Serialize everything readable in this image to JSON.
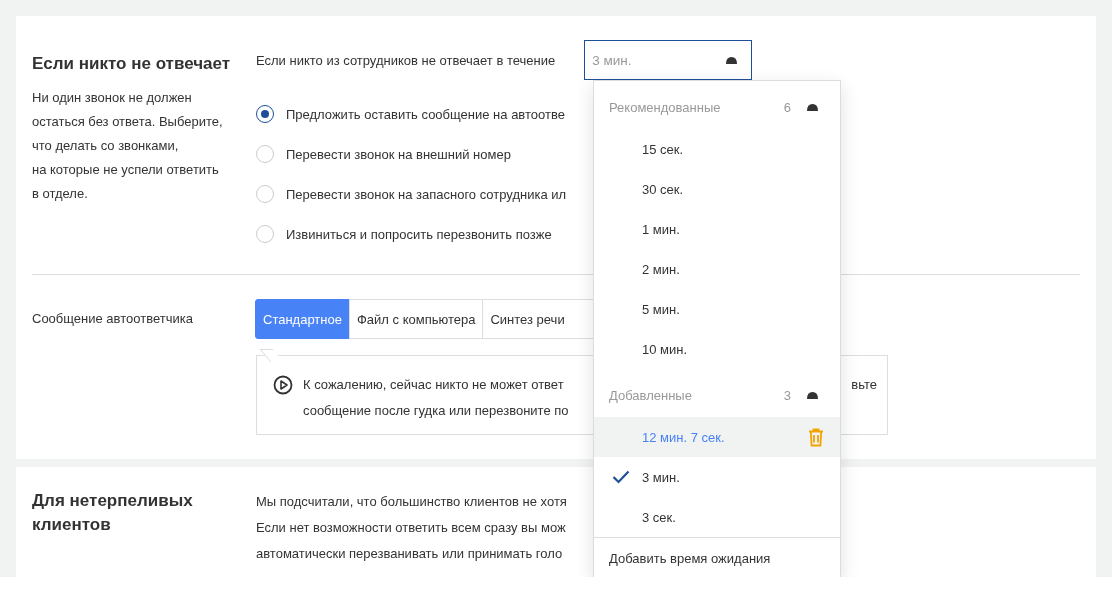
{
  "no_answer": {
    "title": "Если никто не отвечает",
    "description": "Ни один звонок не должен остаться без ответа. Выберите, что делать со звонками,\nна которые не успели ответить в отделе.",
    "timeout_label": "Если никто из сотрудников не отвечает в течение",
    "timeout_select": {
      "value": "3 мин.",
      "expanded": true
    },
    "options": [
      {
        "label": "Предложить оставить сообщение на автоотве",
        "selected": true
      },
      {
        "label": "Перевести звонок на внешний номер",
        "selected": false
      },
      {
        "label": "Перевести звонок на запасного сотрудника ил",
        "selected": false
      },
      {
        "label": "Извиниться и попросить перезвонить позже",
        "selected": false
      }
    ],
    "answering_machine": {
      "label": "Сообщение автоответчика",
      "tabs": [
        {
          "label": "Стандартное",
          "selected": true
        },
        {
          "label": "Файл с компьютера",
          "selected": false
        },
        {
          "label": "Синтез речи",
          "selected": false
        }
      ],
      "message_lines": [
        "К сожалению, сейчас никто не может ответ",
        "сообщение после гудка или перезвоните по"
      ],
      "message_tail": "вьте"
    }
  },
  "timeout_dropdown": {
    "groups": [
      {
        "title": "Рекомендованные",
        "count": "6",
        "expanded": true,
        "items": [
          {
            "label": "15 сек.",
            "selected": false,
            "hovered": false
          },
          {
            "label": "30 сек.",
            "selected": false,
            "hovered": false
          },
          {
            "label": "1 мин.",
            "selected": false,
            "hovered": false
          },
          {
            "label": "2 мин.",
            "selected": false,
            "hovered": false
          },
          {
            "label": "5 мин.",
            "selected": false,
            "hovered": false
          },
          {
            "label": "10 мин.",
            "selected": false,
            "hovered": false
          }
        ]
      },
      {
        "title": "Добавленные",
        "count": "3",
        "expanded": true,
        "items": [
          {
            "label": "12 мин. 7 сек.",
            "selected": false,
            "hovered": true
          },
          {
            "label": "3 мин.",
            "selected": true,
            "hovered": false
          },
          {
            "label": "3 сек.",
            "selected": false,
            "hovered": false
          }
        ]
      }
    ],
    "footer": "Добавить время ожидания"
  },
  "impatient": {
    "title": "Для нетерпеливых клиентов",
    "text": "Мы подсчитали, что большинство клиентов не хотя\nЕсли нет возможности ответить всем сразу вы мож\nавтоматически перезванивать или принимать голо"
  }
}
